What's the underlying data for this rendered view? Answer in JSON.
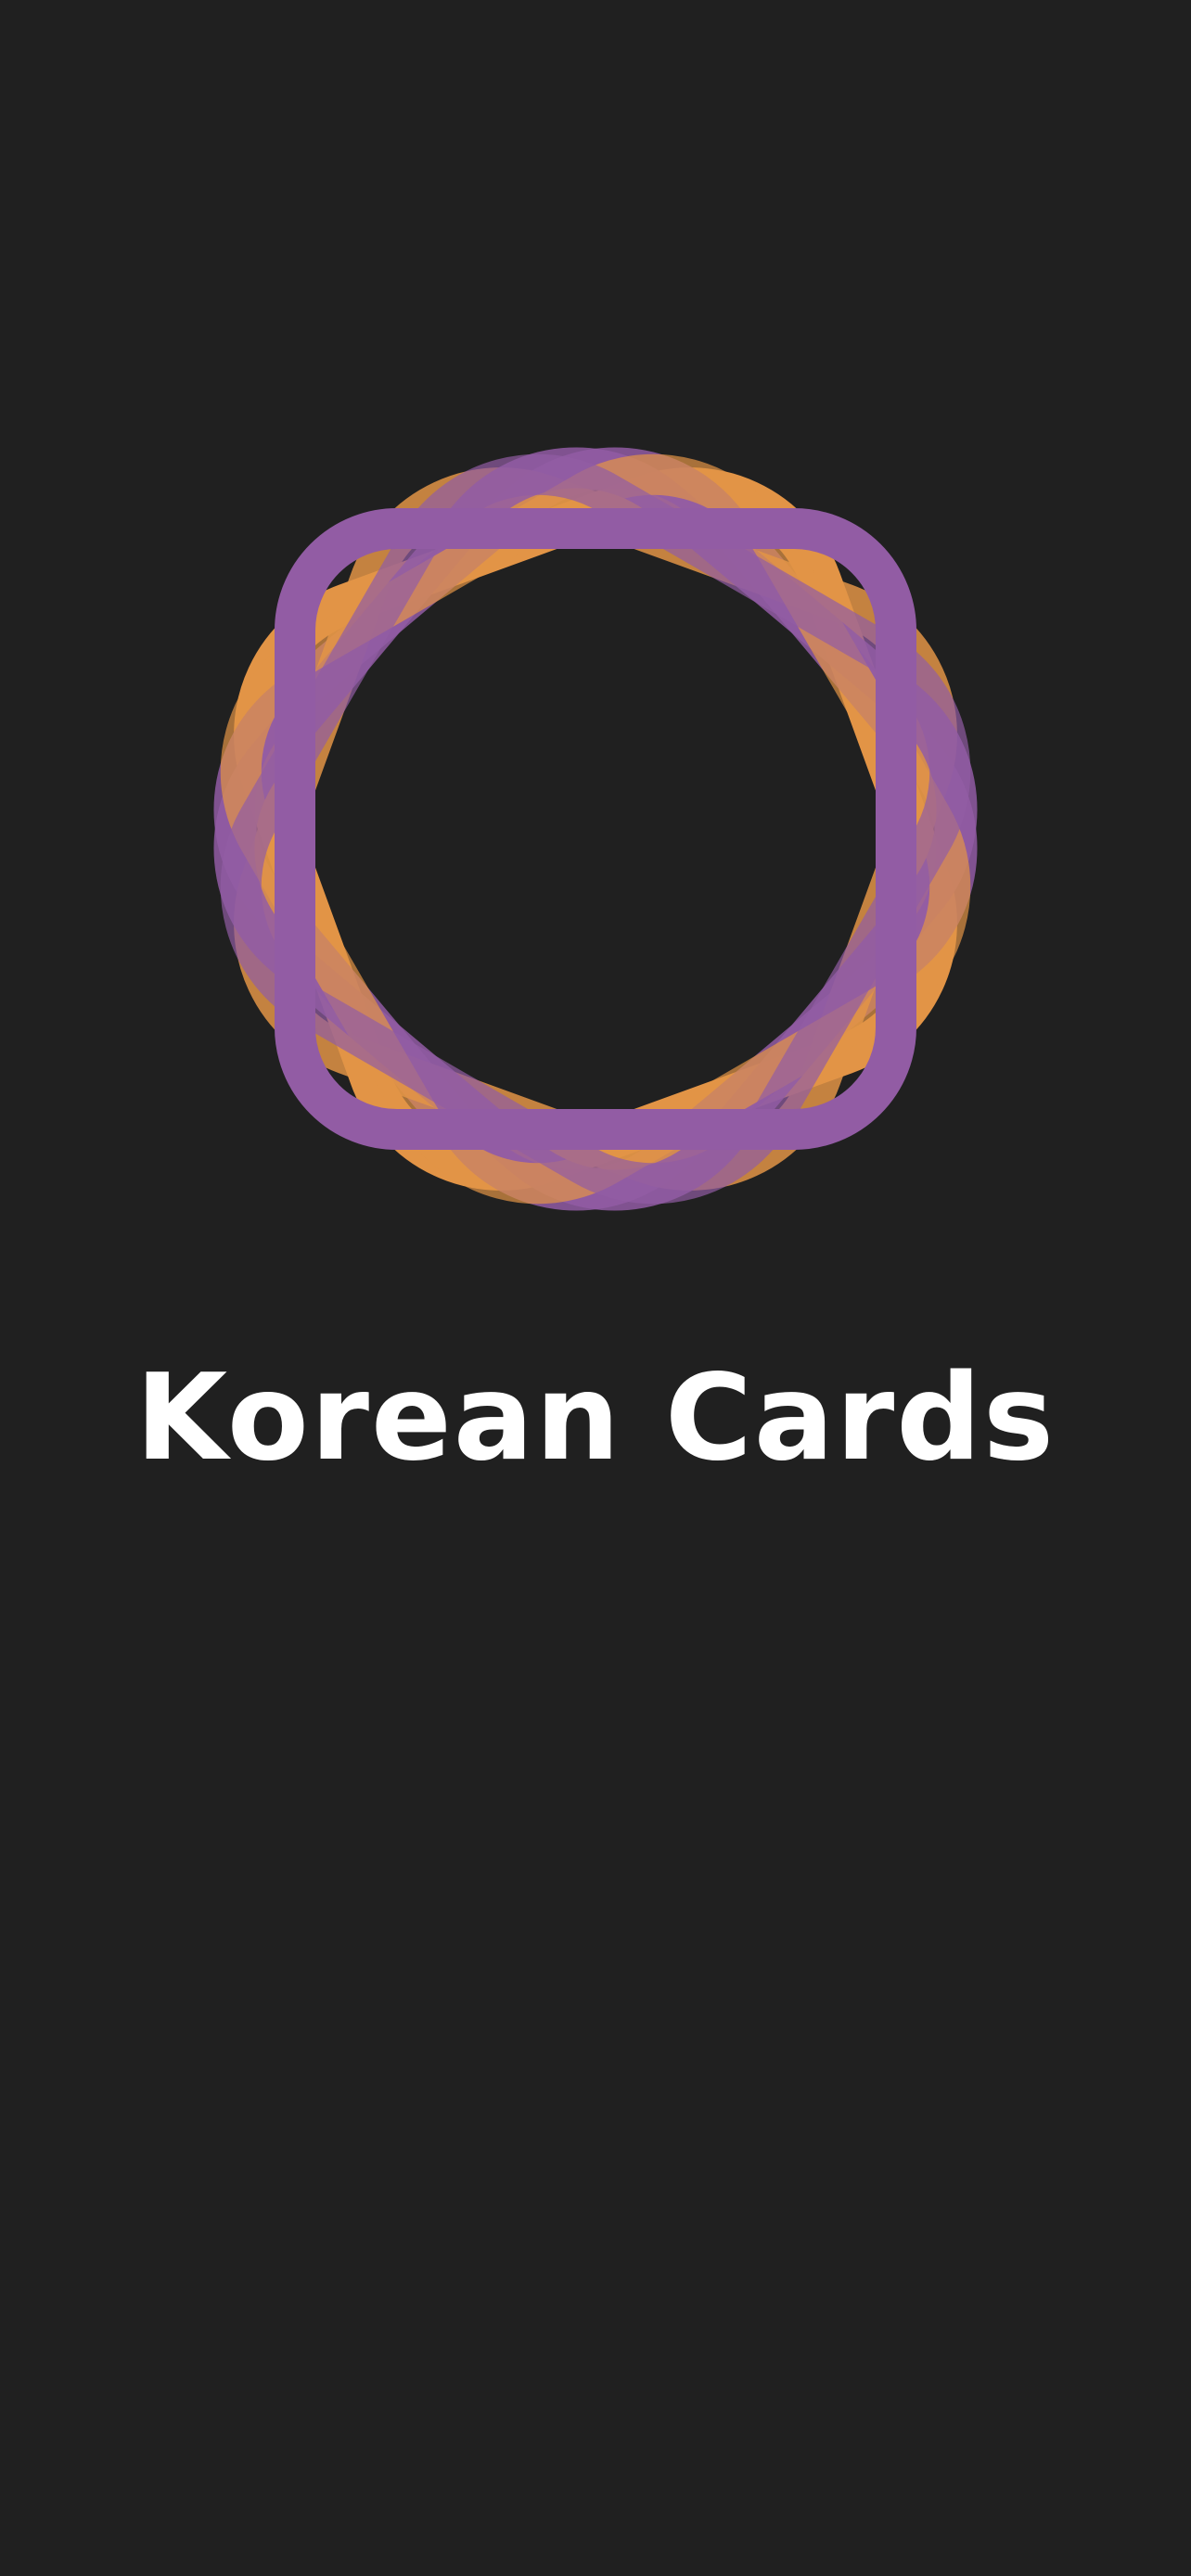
{
  "app": {
    "title": "Korean Cards",
    "logo_icon": "interlocking-rounded-squares-logo-icon"
  },
  "colors": {
    "background": "#202020",
    "title_text": "#FFFFFF",
    "logo_purple": "#925CA4",
    "logo_orange": "#E29446"
  }
}
